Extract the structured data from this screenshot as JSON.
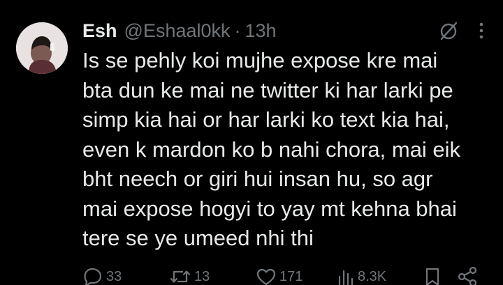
{
  "tweet": {
    "display_name": "Esh",
    "handle": "@Eshaal0kk",
    "separator": "·",
    "time": "13h",
    "text_lines": [
      "Is se pehly koi mujhe expose kre mai",
      "bta dun ke mai ne twitter ki har larki pe",
      "simp kia hai or har larki ko text kia hai,",
      "even k mardon ko b nahi chora, mai eik",
      "bht neech or giri hui insan hu, so agr",
      "mai expose hogyi to yay mt kehna bhai",
      "tere se ye umeed nhi thi"
    ]
  },
  "actions": {
    "replies": "33",
    "reposts": "13",
    "likes": "171",
    "views": "8.3K"
  },
  "icons": {
    "grok": "slashed-circle-icon",
    "more": "more-vertical-icon",
    "reply": "reply-icon",
    "repost": "repost-icon",
    "like": "heart-icon",
    "views": "views-icon",
    "bookmark": "bookmark-icon",
    "share": "share-icon"
  },
  "colors": {
    "background": "#000000",
    "text": "#e7e9ea",
    "muted": "#71767b"
  }
}
